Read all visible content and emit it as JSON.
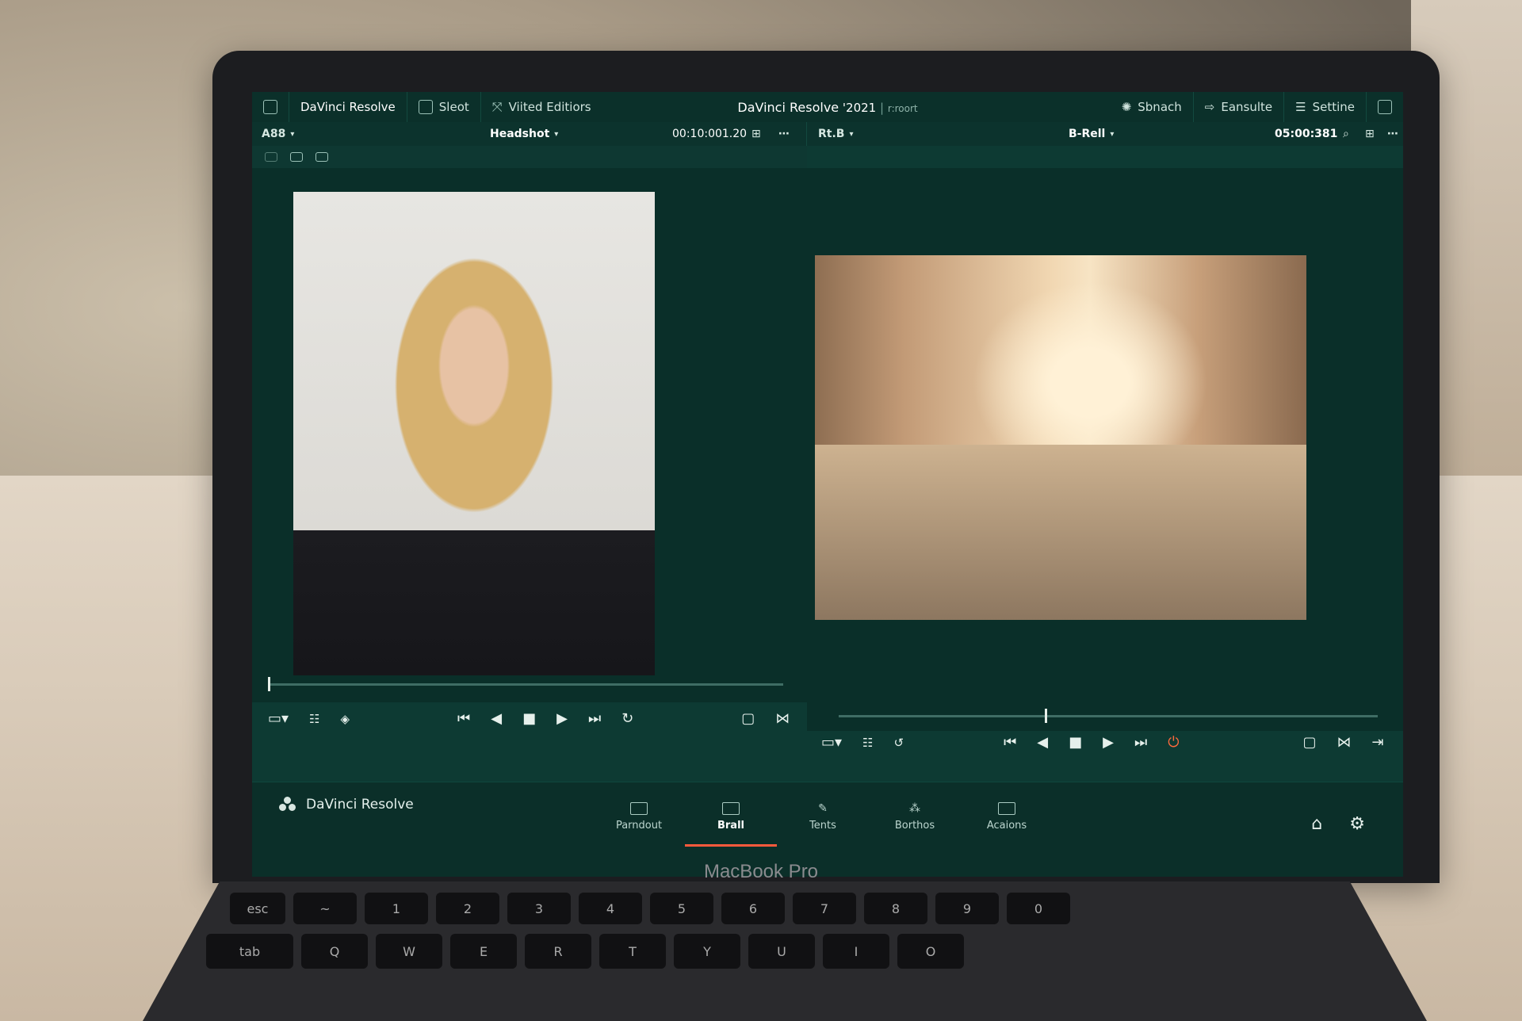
{
  "app": {
    "title": "DaVinci Resolve",
    "title_suffix": "'2021",
    "title_sub": "r:roort"
  },
  "topbar": {
    "left_items": [
      {
        "label": "DaVinci Resolve",
        "icon": "window-icon"
      },
      {
        "label": "Sleot",
        "icon": "image-icon"
      },
      {
        "label": "Viited Editiors",
        "icon": "nodes-icon"
      }
    ],
    "right_items": [
      {
        "label": "Sbnach",
        "icon": "sparkle-icon"
      },
      {
        "label": "Eansulte",
        "icon": "share-icon"
      },
      {
        "label": "Settine",
        "icon": "menu-icon"
      }
    ]
  },
  "left_viewer": {
    "bin_label": "A88",
    "clip_name": "Headshot",
    "timecode": "00:10:001.20"
  },
  "right_viewer": {
    "bin_label": "Rt.B",
    "clip_name": "B-Rell",
    "timecode": "05:00:381"
  },
  "footer": {
    "brand": "DaVinci Resolve",
    "tabs": [
      {
        "label": "Parndout"
      },
      {
        "label": "Brall",
        "active": true
      },
      {
        "label": "Tents"
      },
      {
        "label": "Borthos"
      },
      {
        "label": "Acaions"
      }
    ]
  },
  "device": {
    "label": "MacBook Pro",
    "keys_row1": [
      "esc",
      "~",
      "1",
      "2",
      "3",
      "4",
      "5",
      "6",
      "7",
      "8",
      "9",
      "0"
    ],
    "keys_row2": [
      "tab",
      "Q",
      "W",
      "E",
      "R",
      "T",
      "Y",
      "U",
      "I",
      "O"
    ]
  },
  "colors": {
    "accent": "#ff5a3c",
    "panel": "#0d3a33"
  }
}
